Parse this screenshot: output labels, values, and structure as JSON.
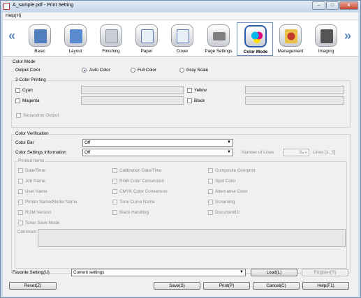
{
  "window": {
    "title": "A_sample.pdf - Print Setting",
    "minimize": "–",
    "maximize": "□",
    "close": "x"
  },
  "menu": {
    "help": "Help(H)"
  },
  "nav": {
    "prev": "«",
    "next": "»"
  },
  "tabs": [
    {
      "label": "Basic",
      "icon": "basic-icon",
      "color": "#4f7fbf"
    },
    {
      "label": "Layout",
      "icon": "layout-icon",
      "color": "#5a8ad0"
    },
    {
      "label": "Finishing",
      "icon": "finishing-icon",
      "color": "#9aa5b3"
    },
    {
      "label": "Paper",
      "icon": "paper-icon",
      "color": "#e8eef8"
    },
    {
      "label": "Cover",
      "icon": "cover-icon",
      "color": "#e8eef8"
    },
    {
      "label": "Page Settings",
      "icon": "page-settings-icon",
      "color": "#7f7f7f"
    },
    {
      "label": "Color Mode",
      "icon": "color-mode-icon",
      "color": "#d43ea0"
    },
    {
      "label": "Management",
      "icon": "management-icon",
      "color": "#c0392b"
    },
    {
      "label": "Imaging",
      "icon": "imaging-icon",
      "color": "#555555"
    }
  ],
  "colorMode": {
    "legend": "Color Mode",
    "outputColor": "Output Color",
    "options": [
      "Auto Color",
      "Full Color",
      "Gray Scale"
    ],
    "selected": "Auto Color"
  },
  "twoColor": {
    "legend": "2-Color Printing",
    "items": [
      "Cyan",
      "Yellow",
      "Magenta",
      "Black"
    ]
  },
  "separation": "Separation Output",
  "verification": {
    "legend": "Color Verification",
    "colorBar": {
      "label": "Color Bar",
      "value": "Off"
    },
    "settingsInfo": {
      "label": "Color Settings Information",
      "value": "Off"
    },
    "numLines": {
      "label": "Number of Lines",
      "value": "3",
      "range": "Lines [1...5]"
    },
    "printedItems": {
      "legend": "Printed Items",
      "items": [
        "Date/Time",
        "Calibration Date/Time",
        "Composite Overprint",
        "Job Name",
        "RGB Color Conversion",
        "Spot Color",
        "User Name",
        "CMYK Color Conversion",
        "Alternative Color",
        "Printer Name/Model Name",
        "Tone Curve Name",
        "Screening",
        "ROM Version",
        "Black Handling",
        "DocumentID",
        "Toner Save Mode"
      ]
    },
    "comment": "Comment"
  },
  "favorite": {
    "label": "Favorite Setting(U)",
    "value": "Current settings",
    "load": "Load(L)",
    "register": "Register(R)"
  },
  "buttons": {
    "reset": "Reset(Z)",
    "save": "Save(S)",
    "print": "Print(P)",
    "cancel": "Cancel(C)",
    "help": "Help(F1)"
  }
}
